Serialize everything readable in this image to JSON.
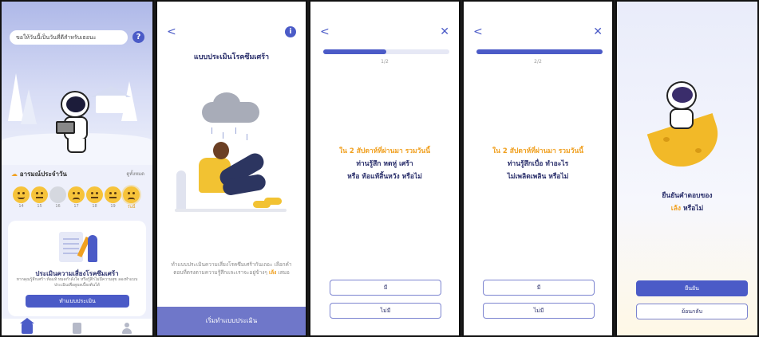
{
  "screen1": {
    "greeting": "ขอให้วันนี้เป็นวันที่ดีสำหรับเธอนะ",
    "help_icon": "question-icon",
    "mood": {
      "prefix": "🌤",
      "title": "อารมณ์ประจำวัน",
      "see_all": "ดูทั้งหมด"
    },
    "mood_days": [
      "14",
      "15",
      "16",
      "17",
      "18",
      "19",
      "วันนี้"
    ],
    "card": {
      "title": "ประเมินความเสี่ยงโรคซึมเศร้า",
      "description": "หากคุณรู้สึกเศร้า ท้อแท้ หมดกำลังใจ หรือรู้สึกไม่มีความสุข ลองทำแบบประเมินเพื่อดูผลเบื้องต้นได้",
      "button": "ทำแบบประเมิน"
    },
    "tabs": [
      "home-icon",
      "document-icon",
      "profile-icon"
    ]
  },
  "screen2": {
    "back": "<",
    "info": "i",
    "title": "แบบประเมินโรคซึมเศร้า",
    "desc_part1": "ทำแบบประเมินความเสี่ยงโรคซึมเศร้ากันเถอะ เลือกคำตอบที่ตรงตามความรู้สึกและเราจะอยู่ข้างๆ ",
    "desc_highlight": "เล้ง",
    "desc_part2": " เสมอ",
    "button": "เริ่มทำแบบประเมิน"
  },
  "screen3": {
    "back": "<",
    "close": "✕",
    "progress": 0.5,
    "step": "1/2",
    "question_lead": "ใน 2 สัปดาห์ที่ผ่านมา รวมวันนี้",
    "question_line1": "ท่านรู้สึก หดหู่ เศร้า",
    "question_line2": "หรือ ท้อแท้สิ้นหวัง หรือไม่",
    "option_yes": "มี",
    "option_no": "ไม่มี"
  },
  "screen4": {
    "back": "<",
    "close": "✕",
    "progress": 1.0,
    "step": "2/2",
    "question_lead": "ใน 2 สัปดาห์ที่ผ่านมา รวมวันนี้",
    "question_line1": "ท่านรู้สึกเบื่อ ทำอะไร",
    "question_line2": "ไม่เพลิดเพลิน หรือไม่",
    "option_yes": "มี",
    "option_no": "ไม่มี"
  },
  "screen5": {
    "confirm_line1": "ยืนยันคำตอบของ",
    "confirm_name": "เล้ง",
    "confirm_suffix": " หรือไม่",
    "button_confirm": "ยืนยัน",
    "button_back": "ย้อนกลับ"
  },
  "colors": {
    "primary": "#4b5bc7",
    "accent": "#f0a020",
    "text_dark": "#2a2f6b"
  }
}
